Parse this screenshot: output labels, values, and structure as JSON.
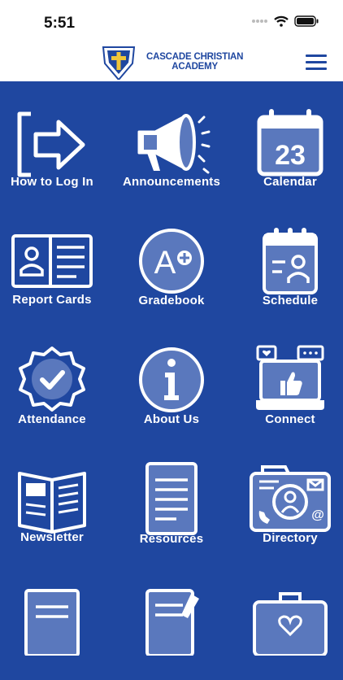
{
  "status_bar": {
    "time": "5:51"
  },
  "header": {
    "school_name_line1": "CASCADE CHRISTIAN",
    "school_name_line2": "ACADEMY",
    "menu_icon": "hamburger-menu-icon"
  },
  "tiles": [
    {
      "label": "How to Log In",
      "icon": "login-arrow-icon"
    },
    {
      "label": "Announcements",
      "icon": "megaphone-icon"
    },
    {
      "label": "Calendar",
      "icon": "calendar-icon",
      "calendar_day": "23"
    },
    {
      "label": "Report Cards",
      "icon": "report-card-icon"
    },
    {
      "label": "Gradebook",
      "icon": "gradebook-icon",
      "grade": "A+"
    },
    {
      "label": "Schedule",
      "icon": "schedule-icon"
    },
    {
      "label": "Attendance",
      "icon": "checkmark-badge-icon"
    },
    {
      "label": "About Us",
      "icon": "info-icon"
    },
    {
      "label": "Connect",
      "icon": "social-connect-icon"
    },
    {
      "label": "Newsletter",
      "icon": "newsletter-icon"
    },
    {
      "label": "Resources",
      "icon": "document-tablet-icon"
    },
    {
      "label": "Directory",
      "icon": "contact-directory-icon"
    }
  ],
  "colors": {
    "brand_blue": "#1f47a0",
    "icon_fill": "#5a78bd",
    "white": "#ffffff"
  }
}
